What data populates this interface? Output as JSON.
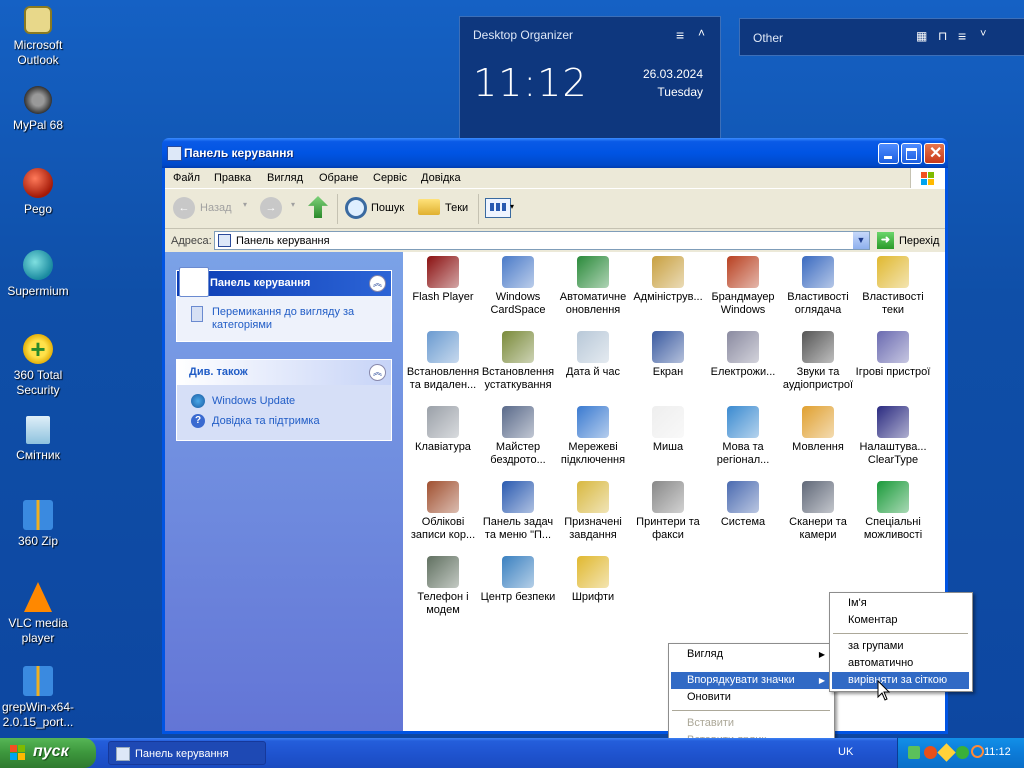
{
  "desktop": {
    "icons": [
      {
        "label": "Microsoft Outlook"
      },
      {
        "label": "MyPal 68"
      },
      {
        "label": "Pego"
      },
      {
        "label": "Supermium"
      },
      {
        "label": "360 Total Security"
      },
      {
        "label": "Смітник"
      },
      {
        "label": "360 Zip"
      },
      {
        "label": "VLC media player"
      },
      {
        "label": "grepWin-x64-2.0.15_port..."
      }
    ]
  },
  "organizer": {
    "title": "Desktop Organizer",
    "time": "11:12",
    "date": "26.03.2024",
    "day": "Tuesday"
  },
  "other_widget": {
    "title": "Other"
  },
  "window": {
    "title": "Панель керування",
    "menu": [
      "Файл",
      "Правка",
      "Вигляд",
      "Обране",
      "Сервіс",
      "Довідка"
    ],
    "toolbar": {
      "back": "Назад",
      "search": "Пошук",
      "folders": "Теки"
    },
    "address": {
      "label": "Адреса:",
      "value": "Панель керування",
      "go": "Перехід"
    }
  },
  "taskpane": {
    "panel_title": "Панель керування",
    "switch_view": "Перемикання до вигляду за категоріями",
    "see_also": "Див. також",
    "links": [
      "Windows Update",
      "Довідка та підтримка"
    ]
  },
  "items": [
    "Flash Player",
    "Windows CardSpace",
    "Автоматичне оновлення",
    "Адмініструв...",
    "Брандмауер Windows",
    "Властивості оглядача",
    "Властивості теки",
    "Встановлення та видален...",
    "Встановлення устаткування",
    "Дата й час",
    "Екран",
    "Електрожи...",
    "Звуки та аудіопристрої",
    "Ігрові пристрої",
    "Клавіатура",
    "Майстер бездрото...",
    "Мережеві підключення",
    "Миша",
    "Мова та регіонал...",
    "Мовлення",
    "Налаштува... ClearType",
    "Облікові записи кор...",
    "Панель задач та меню \"П...",
    "Призначені завдання",
    "Принтери та факси",
    "Система",
    "Сканери та камери",
    "Спеціальні можливості",
    "Телефон і модем",
    "Центр безпеки",
    "Шрифти"
  ],
  "context_menu": {
    "items": [
      "Вигляд",
      "Впорядкувати значки",
      "Оновити",
      "Вставити",
      "Вставити ярлик"
    ]
  },
  "submenu": {
    "items": [
      "Ім'я",
      "Коментар",
      "за групами",
      "автоматично",
      "вирівняти за сіткою"
    ]
  },
  "taskbar": {
    "start": "пуск",
    "task": "Панель керування",
    "lang": "UK",
    "clock": "11:12"
  },
  "colors": {
    "selection": "#316ac5",
    "xp_blue": "#0054e3",
    "start_green": "#3c963c"
  }
}
